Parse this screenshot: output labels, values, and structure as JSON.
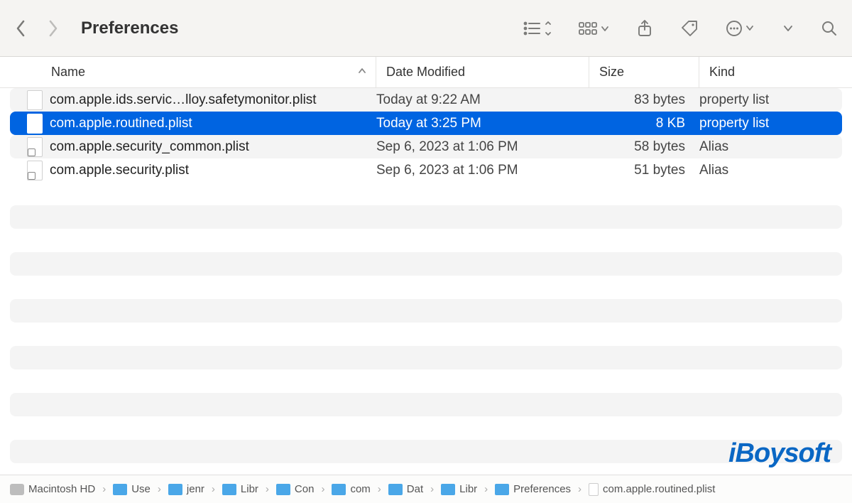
{
  "window": {
    "title": "Preferences"
  },
  "columns": {
    "name": "Name",
    "date": "Date Modified",
    "size": "Size",
    "kind": "Kind"
  },
  "files": [
    {
      "name": "com.apple.ids.servic…lloy.safetymonitor.plist",
      "date": "Today at 9:22 AM",
      "size": "83 bytes",
      "kind": "property list",
      "alias": false,
      "selected": false
    },
    {
      "name": "com.apple.routined.plist",
      "date": "Today at 3:25 PM",
      "size": "8 KB",
      "kind": "property list",
      "alias": false,
      "selected": true
    },
    {
      "name": "com.apple.security_common.plist",
      "date": "Sep 6, 2023 at 1:06 PM",
      "size": "58 bytes",
      "kind": "Alias",
      "alias": true,
      "selected": false
    },
    {
      "name": "com.apple.security.plist",
      "date": "Sep 6, 2023 at 1:06 PM",
      "size": "51 bytes",
      "kind": "Alias",
      "alias": true,
      "selected": false
    }
  ],
  "path": [
    {
      "label": "Macintosh HD",
      "type": "hd"
    },
    {
      "label": "Use",
      "type": "folder"
    },
    {
      "label": "jenr",
      "type": "folder"
    },
    {
      "label": "Libr",
      "type": "folder"
    },
    {
      "label": "Con",
      "type": "folder"
    },
    {
      "label": "com",
      "type": "folder"
    },
    {
      "label": "Dat",
      "type": "folder"
    },
    {
      "label": "Libr",
      "type": "folder"
    },
    {
      "label": "Preferences",
      "type": "folder"
    },
    {
      "label": "com.apple.routined.plist",
      "type": "file"
    }
  ],
  "watermark": "iBoysoft"
}
